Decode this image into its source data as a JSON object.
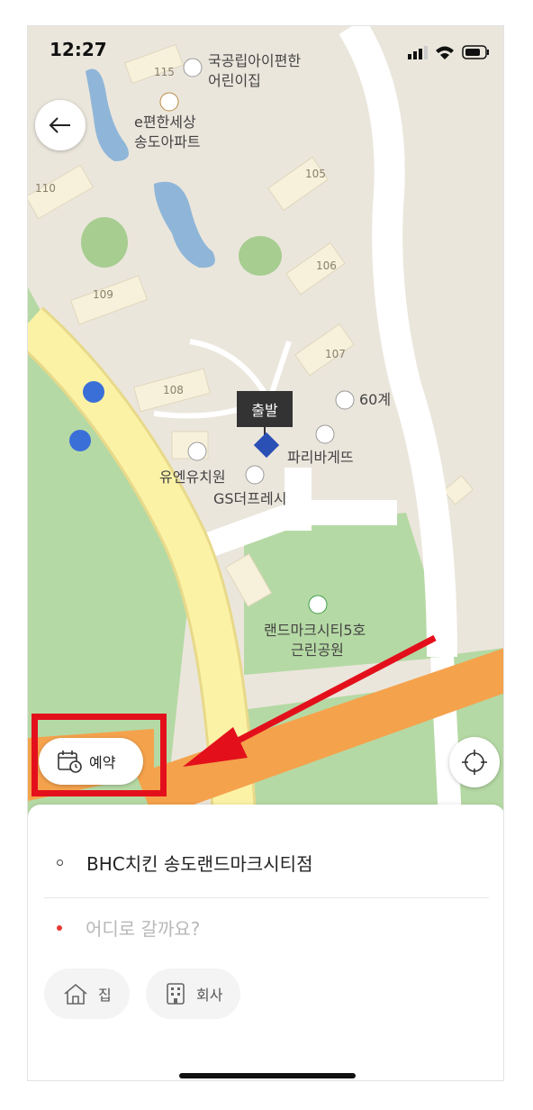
{
  "status_bar": {
    "time": "12:27"
  },
  "map": {
    "labels": {
      "daycare": "국공립아이편한\n어린이집",
      "daycare_line1": "국공립아이편한",
      "daycare_line2": "어린이집",
      "apartment_line1": "e편한세상",
      "apartment_line2": "송도아파트",
      "kindergarten": "유엔유치원",
      "gs_fresh": "GS더프레시",
      "paris": "파리바게뜨",
      "restaurant": "60계",
      "park_line1": "랜드마크시티5호",
      "park_line2": "근린공원"
    },
    "buildings": [
      "115",
      "110",
      "105",
      "106",
      "109",
      "107",
      "108"
    ],
    "marker_label": "출발"
  },
  "buttons": {
    "reserve": "예약"
  },
  "sheet": {
    "origin": "BHC치킨 송도랜드마크시티점",
    "destination_placeholder": "어디로 갈까요?",
    "chips": {
      "home": "집",
      "work": "회사"
    }
  },
  "colors": {
    "map_bg": "#ebe6dc",
    "highway": "#f5a24c",
    "yellow_road": "#fbf2a6",
    "park": "#b5d9a4",
    "annotation": "#e3101c"
  }
}
